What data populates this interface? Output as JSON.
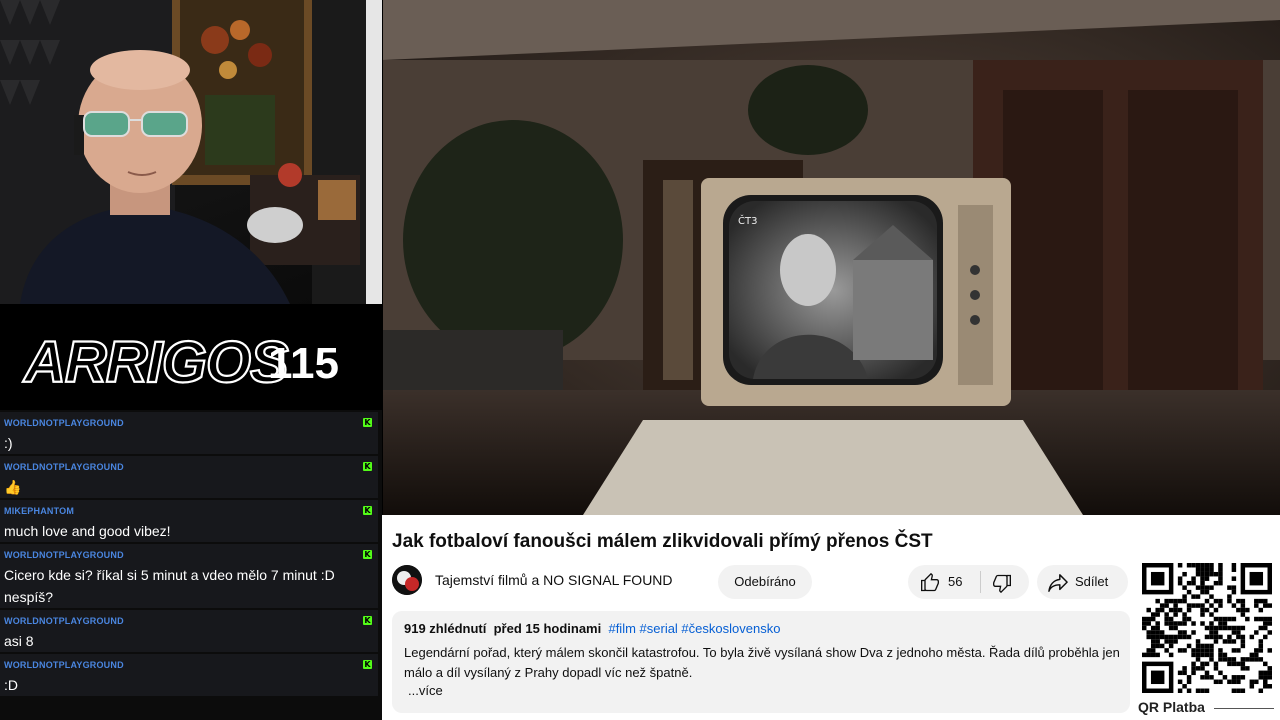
{
  "branding": {
    "name": "ARRIGOS",
    "number": "115"
  },
  "chat": {
    "messages": [
      {
        "user": "WORLDNOTPLAYGROUND",
        "text": ":)"
      },
      {
        "user": "WORLDNOTPLAYGROUND",
        "text": "👍"
      },
      {
        "user": "MIKEPHANTOM",
        "text": "much love and good vibez!"
      },
      {
        "user": "WORLDNOTPLAYGROUND",
        "text": "Cicero kde si? říkal si 5 minut a vdeo mělo 7 minut :D nespíš?"
      },
      {
        "user": "WORLDNOTPLAYGROUND",
        "text": "asi 8"
      },
      {
        "user": "WORLDNOTPLAYGROUND",
        "text": ":D"
      }
    ],
    "badge_letter": "K",
    "colors": {
      "username": "#4a86e0",
      "badge": "#53fc18",
      "bubble": "#17181c"
    }
  },
  "video": {
    "title": "Jak fotbaloví fanoušci málem zlikvidovali přímý přenos ČST",
    "channel": "Tajemství filmů a NO SIGNAL FOUND",
    "subscribe_label": "Odebíráno",
    "likes": "56",
    "share_label": "Sdílet",
    "views": "919 zhlédnutí",
    "age": "před 15 hodinami",
    "tags": "#film #serial #československo",
    "description": "Legendární pořad, který málem skončil katastrofou. To byla živě vysílaná show Dva z jednoho města. Řada dílů proběhla jen málo a díl vysílaný z Prahy dopadl víc než špatně.",
    "more_label": "...více",
    "tv_logo": "ČT3"
  },
  "qr": {
    "label": "QR Platba"
  },
  "icons": {
    "like": "thumbs-up-icon",
    "dislike": "thumbs-down-icon",
    "share": "share-arrow-icon",
    "channel": "channel-avatar-icon",
    "qr": "qr-code-icon"
  }
}
